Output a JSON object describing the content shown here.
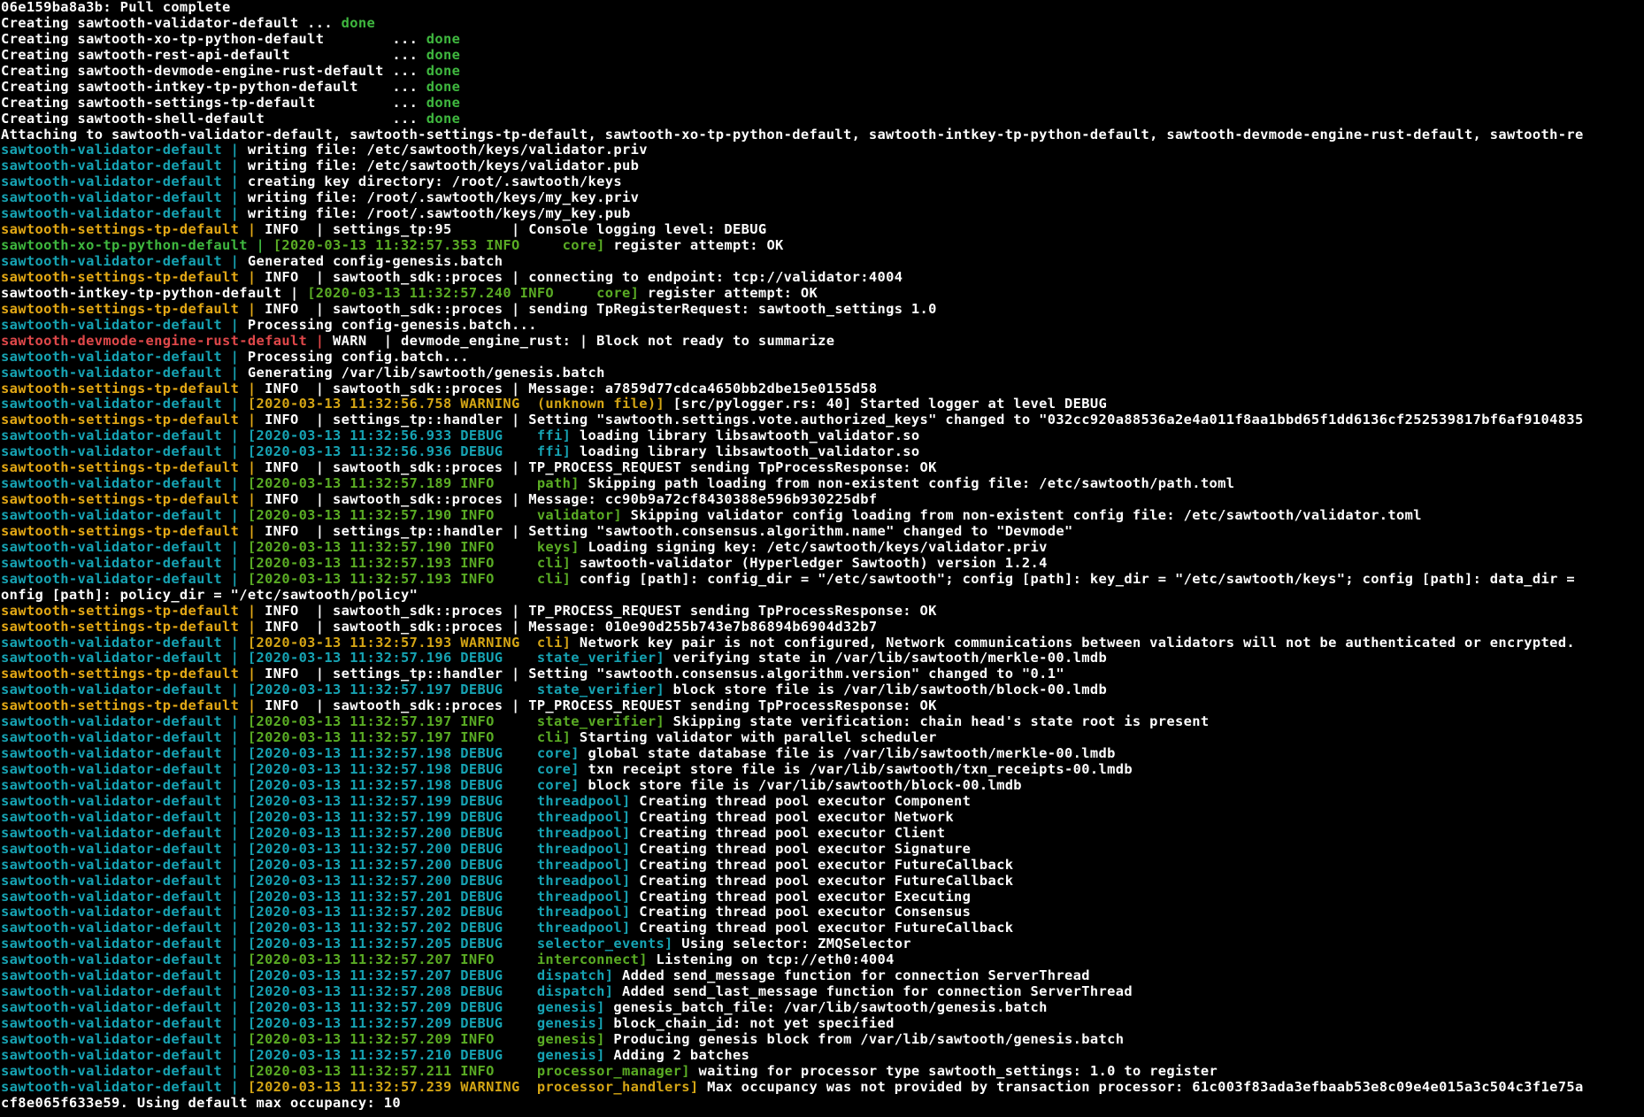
{
  "colors": {
    "text": "#ffffff",
    "cyan": "#16a3b3",
    "yellow": "#e3a815",
    "green": "#3fb83f",
    "red": "#e0484a",
    "darkcyan": "#16a3b3",
    "tsgreen": "#5aac24",
    "tsyellow": "#d4a515"
  },
  "lines": [
    [
      {
        "t": "06e159ba8a3b: Pull complete",
        "c": "text"
      }
    ],
    [
      {
        "t": "Creating sawtooth-validator-default ... ",
        "c": "text"
      },
      {
        "t": "done",
        "c": "green"
      }
    ],
    [
      {
        "t": "Creating sawtooth-xo-tp-python-default        ... ",
        "c": "text"
      },
      {
        "t": "done",
        "c": "green"
      }
    ],
    [
      {
        "t": "Creating sawtooth-rest-api-default            ... ",
        "c": "text"
      },
      {
        "t": "done",
        "c": "green"
      }
    ],
    [
      {
        "t": "Creating sawtooth-devmode-engine-rust-default ... ",
        "c": "text"
      },
      {
        "t": "done",
        "c": "green"
      }
    ],
    [
      {
        "t": "Creating sawtooth-intkey-tp-python-default    ... ",
        "c": "text"
      },
      {
        "t": "done",
        "c": "green"
      }
    ],
    [
      {
        "t": "Creating sawtooth-settings-tp-default         ... ",
        "c": "text"
      },
      {
        "t": "done",
        "c": "green"
      }
    ],
    [
      {
        "t": "Creating sawtooth-shell-default               ... ",
        "c": "text"
      },
      {
        "t": "done",
        "c": "green"
      }
    ],
    [
      {
        "t": "Attaching to sawtooth-validator-default, sawtooth-settings-tp-default, sawtooth-xo-tp-python-default, sawtooth-intkey-tp-python-default, sawtooth-devmode-engine-rust-default, sawtooth-re",
        "c": "text"
      }
    ],
    [
      {
        "t": "sawtooth-validator-default | ",
        "c": "cyan"
      },
      {
        "t": "writing file: /etc/sawtooth/keys/validator.priv",
        "c": "text"
      }
    ],
    [
      {
        "t": "sawtooth-validator-default | ",
        "c": "cyan"
      },
      {
        "t": "writing file: /etc/sawtooth/keys/validator.pub",
        "c": "text"
      }
    ],
    [
      {
        "t": "sawtooth-validator-default | ",
        "c": "cyan"
      },
      {
        "t": "creating key directory: /root/.sawtooth/keys",
        "c": "text"
      }
    ],
    [
      {
        "t": "sawtooth-validator-default | ",
        "c": "cyan"
      },
      {
        "t": "writing file: /root/.sawtooth/keys/my_key.priv",
        "c": "text"
      }
    ],
    [
      {
        "t": "sawtooth-validator-default | ",
        "c": "cyan"
      },
      {
        "t": "writing file: /root/.sawtooth/keys/my_key.pub",
        "c": "text"
      }
    ],
    [
      {
        "t": "sawtooth-settings-tp-default | ",
        "c": "yellow"
      },
      {
        "t": "INFO  | settings_tp:95       | Console logging level: DEBUG",
        "c": "text"
      }
    ],
    [
      {
        "t": "sawtooth-xo-tp-python-default | ",
        "c": "green"
      },
      {
        "t": "[2020-03-13 11:32:57.353 INFO     core] ",
        "c": "tsgreen"
      },
      {
        "t": "register attempt: OK",
        "c": "text"
      }
    ],
    [
      {
        "t": "sawtooth-validator-default | ",
        "c": "cyan"
      },
      {
        "t": "Generated config-genesis.batch",
        "c": "text"
      }
    ],
    [
      {
        "t": "sawtooth-settings-tp-default | ",
        "c": "yellow"
      },
      {
        "t": "INFO  | sawtooth_sdk::proces | connecting to endpoint: tcp://validator:4004",
        "c": "text"
      }
    ],
    [
      {
        "t": "sawtooth-intkey-tp-python-default | ",
        "c": "text"
      },
      {
        "t": "[2020-03-13 11:32:57.240 INFO     core] ",
        "c": "tsgreen"
      },
      {
        "t": "register attempt: OK",
        "c": "text"
      }
    ],
    [
      {
        "t": "sawtooth-settings-tp-default | ",
        "c": "yellow"
      },
      {
        "t": "INFO  | sawtooth_sdk::proces | sending TpRegisterRequest: sawtooth_settings 1.0",
        "c": "text"
      }
    ],
    [
      {
        "t": "sawtooth-validator-default | ",
        "c": "cyan"
      },
      {
        "t": "Processing config-genesis.batch...",
        "c": "text"
      }
    ],
    [
      {
        "t": "sawtooth-devmode-engine-rust-default | ",
        "c": "red"
      },
      {
        "t": "WARN  | devmode_engine_rust: | Block not ready to summarize",
        "c": "text"
      }
    ],
    [
      {
        "t": "sawtooth-validator-default | ",
        "c": "cyan"
      },
      {
        "t": "Processing config.batch...",
        "c": "text"
      }
    ],
    [
      {
        "t": "sawtooth-validator-default | ",
        "c": "cyan"
      },
      {
        "t": "Generating /var/lib/sawtooth/genesis.batch",
        "c": "text"
      }
    ],
    [
      {
        "t": "sawtooth-settings-tp-default | ",
        "c": "yellow"
      },
      {
        "t": "INFO  | sawtooth_sdk::proces | Message: a7859d77cdca4650bb2dbe15e0155d58",
        "c": "text"
      }
    ],
    [
      {
        "t": "sawtooth-validator-default | ",
        "c": "cyan"
      },
      {
        "t": "[2020-03-13 11:32:56.758 WARNING  (unknown file)] ",
        "c": "tsyellow"
      },
      {
        "t": "[src/pylogger.rs: 40] Started logger at level DEBUG",
        "c": "text"
      }
    ],
    [
      {
        "t": "sawtooth-settings-tp-default | ",
        "c": "yellow"
      },
      {
        "t": "INFO  | settings_tp::handler | Setting \"sawtooth.settings.vote.authorized_keys\" changed to \"032cc920a88536a2e4a011f8aa1bbd65f1dd6136cf252539817bf6af9104835",
        "c": "text"
      }
    ],
    [
      {
        "t": "sawtooth-validator-default | ",
        "c": "cyan"
      },
      {
        "t": "[2020-03-13 11:32:56.933 DEBUG    ffi] ",
        "c": "darkcyan"
      },
      {
        "t": "loading library libsawtooth_validator.so",
        "c": "text"
      }
    ],
    [
      {
        "t": "sawtooth-validator-default | ",
        "c": "cyan"
      },
      {
        "t": "[2020-03-13 11:32:56.936 DEBUG    ffi] ",
        "c": "darkcyan"
      },
      {
        "t": "loading library libsawtooth_validator.so",
        "c": "text"
      }
    ],
    [
      {
        "t": "sawtooth-settings-tp-default | ",
        "c": "yellow"
      },
      {
        "t": "INFO  | sawtooth_sdk::proces | TP_PROCESS_REQUEST sending TpProcessResponse: OK",
        "c": "text"
      }
    ],
    [
      {
        "t": "sawtooth-validator-default | ",
        "c": "cyan"
      },
      {
        "t": "[2020-03-13 11:32:57.189 INFO     path] ",
        "c": "tsgreen"
      },
      {
        "t": "Skipping path loading from non-existent config file: /etc/sawtooth/path.toml",
        "c": "text"
      }
    ],
    [
      {
        "t": "sawtooth-settings-tp-default | ",
        "c": "yellow"
      },
      {
        "t": "INFO  | sawtooth_sdk::proces | Message: cc90b9a72cf8430388e596b930225dbf",
        "c": "text"
      }
    ],
    [
      {
        "t": "sawtooth-validator-default | ",
        "c": "cyan"
      },
      {
        "t": "[2020-03-13 11:32:57.190 INFO     validator] ",
        "c": "tsgreen"
      },
      {
        "t": "Skipping validator config loading from non-existent config file: /etc/sawtooth/validator.toml",
        "c": "text"
      }
    ],
    [
      {
        "t": "sawtooth-settings-tp-default | ",
        "c": "yellow"
      },
      {
        "t": "INFO  | settings_tp::handler | Setting \"sawtooth.consensus.algorithm.name\" changed to \"Devmode\"",
        "c": "text"
      }
    ],
    [
      {
        "t": "sawtooth-validator-default | ",
        "c": "cyan"
      },
      {
        "t": "[2020-03-13 11:32:57.190 INFO     keys] ",
        "c": "tsgreen"
      },
      {
        "t": "Loading signing key: /etc/sawtooth/keys/validator.priv",
        "c": "text"
      }
    ],
    [
      {
        "t": "sawtooth-validator-default | ",
        "c": "cyan"
      },
      {
        "t": "[2020-03-13 11:32:57.193 INFO     cli] ",
        "c": "tsgreen"
      },
      {
        "t": "sawtooth-validator (Hyperledger Sawtooth) version 1.2.4",
        "c": "text"
      }
    ],
    [
      {
        "t": "sawtooth-validator-default | ",
        "c": "cyan"
      },
      {
        "t": "[2020-03-13 11:32:57.193 INFO     cli] ",
        "c": "tsgreen"
      },
      {
        "t": "config [path]: config_dir = \"/etc/sawtooth\"; config [path]: key_dir = \"/etc/sawtooth/keys\"; config [path]: data_dir =",
        "c": "text"
      }
    ],
    [
      {
        "t": "onfig [path]: policy_dir = \"/etc/sawtooth/policy\"",
        "c": "text"
      }
    ],
    [
      {
        "t": "sawtooth-settings-tp-default | ",
        "c": "yellow"
      },
      {
        "t": "INFO  | sawtooth_sdk::proces | TP_PROCESS_REQUEST sending TpProcessResponse: OK",
        "c": "text"
      }
    ],
    [
      {
        "t": "sawtooth-settings-tp-default | ",
        "c": "yellow"
      },
      {
        "t": "INFO  | sawtooth_sdk::proces | Message: 010e90d255b743e7b86894b6904d32b7",
        "c": "text"
      }
    ],
    [
      {
        "t": "sawtooth-validator-default | ",
        "c": "cyan"
      },
      {
        "t": "[2020-03-13 11:32:57.193 WARNING  cli] ",
        "c": "tsyellow"
      },
      {
        "t": "Network key pair is not configured, Network communications between validators will not be authenticated or encrypted.",
        "c": "text"
      }
    ],
    [
      {
        "t": "sawtooth-validator-default | ",
        "c": "cyan"
      },
      {
        "t": "[2020-03-13 11:32:57.196 DEBUG    state_verifier] ",
        "c": "darkcyan"
      },
      {
        "t": "verifying state in /var/lib/sawtooth/merkle-00.lmdb",
        "c": "text"
      }
    ],
    [
      {
        "t": "sawtooth-settings-tp-default | ",
        "c": "yellow"
      },
      {
        "t": "INFO  | settings_tp::handler | Setting \"sawtooth.consensus.algorithm.version\" changed to \"0.1\"",
        "c": "text"
      }
    ],
    [
      {
        "t": "sawtooth-validator-default | ",
        "c": "cyan"
      },
      {
        "t": "[2020-03-13 11:32:57.197 DEBUG    state_verifier] ",
        "c": "darkcyan"
      },
      {
        "t": "block store file is /var/lib/sawtooth/block-00.lmdb",
        "c": "text"
      }
    ],
    [
      {
        "t": "sawtooth-settings-tp-default | ",
        "c": "yellow"
      },
      {
        "t": "INFO  | sawtooth_sdk::proces | TP_PROCESS_REQUEST sending TpProcessResponse: OK",
        "c": "text"
      }
    ],
    [
      {
        "t": "sawtooth-validator-default | ",
        "c": "cyan"
      },
      {
        "t": "[2020-03-13 11:32:57.197 INFO     state_verifier] ",
        "c": "tsgreen"
      },
      {
        "t": "Skipping state verification: chain head's state root is present",
        "c": "text"
      }
    ],
    [
      {
        "t": "sawtooth-validator-default | ",
        "c": "cyan"
      },
      {
        "t": "[2020-03-13 11:32:57.197 INFO     cli] ",
        "c": "tsgreen"
      },
      {
        "t": "Starting validator with parallel scheduler",
        "c": "text"
      }
    ],
    [
      {
        "t": "sawtooth-validator-default | ",
        "c": "cyan"
      },
      {
        "t": "[2020-03-13 11:32:57.198 DEBUG    core] ",
        "c": "darkcyan"
      },
      {
        "t": "global state database file is /var/lib/sawtooth/merkle-00.lmdb",
        "c": "text"
      }
    ],
    [
      {
        "t": "sawtooth-validator-default | ",
        "c": "cyan"
      },
      {
        "t": "[2020-03-13 11:32:57.198 DEBUG    core] ",
        "c": "darkcyan"
      },
      {
        "t": "txn receipt store file is /var/lib/sawtooth/txn_receipts-00.lmdb",
        "c": "text"
      }
    ],
    [
      {
        "t": "sawtooth-validator-default | ",
        "c": "cyan"
      },
      {
        "t": "[2020-03-13 11:32:57.198 DEBUG    core] ",
        "c": "darkcyan"
      },
      {
        "t": "block store file is /var/lib/sawtooth/block-00.lmdb",
        "c": "text"
      }
    ],
    [
      {
        "t": "sawtooth-validator-default | ",
        "c": "cyan"
      },
      {
        "t": "[2020-03-13 11:32:57.199 DEBUG    threadpool] ",
        "c": "darkcyan"
      },
      {
        "t": "Creating thread pool executor Component",
        "c": "text"
      }
    ],
    [
      {
        "t": "sawtooth-validator-default | ",
        "c": "cyan"
      },
      {
        "t": "[2020-03-13 11:32:57.199 DEBUG    threadpool] ",
        "c": "darkcyan"
      },
      {
        "t": "Creating thread pool executor Network",
        "c": "text"
      }
    ],
    [
      {
        "t": "sawtooth-validator-default | ",
        "c": "cyan"
      },
      {
        "t": "[2020-03-13 11:32:57.200 DEBUG    threadpool] ",
        "c": "darkcyan"
      },
      {
        "t": "Creating thread pool executor Client",
        "c": "text"
      }
    ],
    [
      {
        "t": "sawtooth-validator-default | ",
        "c": "cyan"
      },
      {
        "t": "[2020-03-13 11:32:57.200 DEBUG    threadpool] ",
        "c": "darkcyan"
      },
      {
        "t": "Creating thread pool executor Signature",
        "c": "text"
      }
    ],
    [
      {
        "t": "sawtooth-validator-default | ",
        "c": "cyan"
      },
      {
        "t": "[2020-03-13 11:32:57.200 DEBUG    threadpool] ",
        "c": "darkcyan"
      },
      {
        "t": "Creating thread pool executor FutureCallback",
        "c": "text"
      }
    ],
    [
      {
        "t": "sawtooth-validator-default | ",
        "c": "cyan"
      },
      {
        "t": "[2020-03-13 11:32:57.200 DEBUG    threadpool] ",
        "c": "darkcyan"
      },
      {
        "t": "Creating thread pool executor FutureCallback",
        "c": "text"
      }
    ],
    [
      {
        "t": "sawtooth-validator-default | ",
        "c": "cyan"
      },
      {
        "t": "[2020-03-13 11:32:57.201 DEBUG    threadpool] ",
        "c": "darkcyan"
      },
      {
        "t": "Creating thread pool executor Executing",
        "c": "text"
      }
    ],
    [
      {
        "t": "sawtooth-validator-default | ",
        "c": "cyan"
      },
      {
        "t": "[2020-03-13 11:32:57.202 DEBUG    threadpool] ",
        "c": "darkcyan"
      },
      {
        "t": "Creating thread pool executor Consensus",
        "c": "text"
      }
    ],
    [
      {
        "t": "sawtooth-validator-default | ",
        "c": "cyan"
      },
      {
        "t": "[2020-03-13 11:32:57.202 DEBUG    threadpool] ",
        "c": "darkcyan"
      },
      {
        "t": "Creating thread pool executor FutureCallback",
        "c": "text"
      }
    ],
    [
      {
        "t": "sawtooth-validator-default | ",
        "c": "cyan"
      },
      {
        "t": "[2020-03-13 11:32:57.205 DEBUG    selector_events] ",
        "c": "darkcyan"
      },
      {
        "t": "Using selector: ZMQSelector",
        "c": "text"
      }
    ],
    [
      {
        "t": "sawtooth-validator-default | ",
        "c": "cyan"
      },
      {
        "t": "[2020-03-13 11:32:57.207 INFO     interconnect] ",
        "c": "tsgreen"
      },
      {
        "t": "Listening on tcp://eth0:4004",
        "c": "text"
      }
    ],
    [
      {
        "t": "sawtooth-validator-default | ",
        "c": "cyan"
      },
      {
        "t": "[2020-03-13 11:32:57.207 DEBUG    dispatch] ",
        "c": "darkcyan"
      },
      {
        "t": "Added send_message function for connection ServerThread",
        "c": "text"
      }
    ],
    [
      {
        "t": "sawtooth-validator-default | ",
        "c": "cyan"
      },
      {
        "t": "[2020-03-13 11:32:57.208 DEBUG    dispatch] ",
        "c": "darkcyan"
      },
      {
        "t": "Added send_last_message function for connection ServerThread",
        "c": "text"
      }
    ],
    [
      {
        "t": "sawtooth-validator-default | ",
        "c": "cyan"
      },
      {
        "t": "[2020-03-13 11:32:57.209 DEBUG    genesis] ",
        "c": "darkcyan"
      },
      {
        "t": "genesis_batch_file: /var/lib/sawtooth/genesis.batch",
        "c": "text"
      }
    ],
    [
      {
        "t": "sawtooth-validator-default | ",
        "c": "cyan"
      },
      {
        "t": "[2020-03-13 11:32:57.209 DEBUG    genesis] ",
        "c": "darkcyan"
      },
      {
        "t": "block_chain_id: not yet specified",
        "c": "text"
      }
    ],
    [
      {
        "t": "sawtooth-validator-default | ",
        "c": "cyan"
      },
      {
        "t": "[2020-03-13 11:32:57.209 INFO     genesis] ",
        "c": "tsgreen"
      },
      {
        "t": "Producing genesis block from /var/lib/sawtooth/genesis.batch",
        "c": "text"
      }
    ],
    [
      {
        "t": "sawtooth-validator-default | ",
        "c": "cyan"
      },
      {
        "t": "[2020-03-13 11:32:57.210 DEBUG    genesis] ",
        "c": "darkcyan"
      },
      {
        "t": "Adding 2 batches",
        "c": "text"
      }
    ],
    [
      {
        "t": "sawtooth-validator-default | ",
        "c": "cyan"
      },
      {
        "t": "[2020-03-13 11:32:57.211 INFO     processor_manager] ",
        "c": "tsgreen"
      },
      {
        "t": "waiting for processor type sawtooth_settings: 1.0 to register",
        "c": "text"
      }
    ],
    [
      {
        "t": "sawtooth-validator-default | ",
        "c": "cyan"
      },
      {
        "t": "[2020-03-13 11:32:57.239 WARNING  processor_handlers] ",
        "c": "tsyellow"
      },
      {
        "t": "Max occupancy was not provided by transaction processor: 61c003f83ada3efbaab53e8c09e4e015a3c504c3f1e75a",
        "c": "text"
      }
    ],
    [
      {
        "t": "cf8e065f633e59. Using default max occupancy: 10",
        "c": "text"
      }
    ]
  ]
}
